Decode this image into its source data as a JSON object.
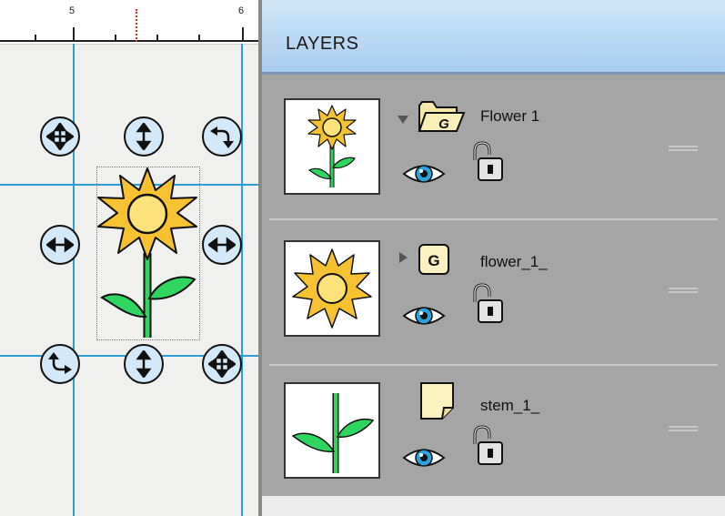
{
  "ruler": {
    "labels": [
      "5",
      "6"
    ]
  },
  "panel": {
    "title": "LAYERS"
  },
  "layers": [
    {
      "name": "Flower 1",
      "icon": "group-folder-icon",
      "icon_letter": "G",
      "expanded": true,
      "thumbnail": "flower-with-stem",
      "visible": true,
      "locked": false
    },
    {
      "name": "flower_1_",
      "icon": "group-icon",
      "icon_letter": "G",
      "expanded": false,
      "thumbnail": "flower-head",
      "visible": true,
      "locked": false
    },
    {
      "name": "stem_1_",
      "icon": "path-icon",
      "icon_letter": "",
      "expanded": null,
      "thumbnail": "stem",
      "visible": true,
      "locked": false
    }
  ],
  "colors": {
    "guide": "#2a9fd6",
    "handle_fill": "#d3e8f8",
    "petal": "#f7c231",
    "center": "#fbe27a",
    "stem": "#2ed55f",
    "header": "#b9d8f2",
    "panel": "#a5a5a5"
  }
}
